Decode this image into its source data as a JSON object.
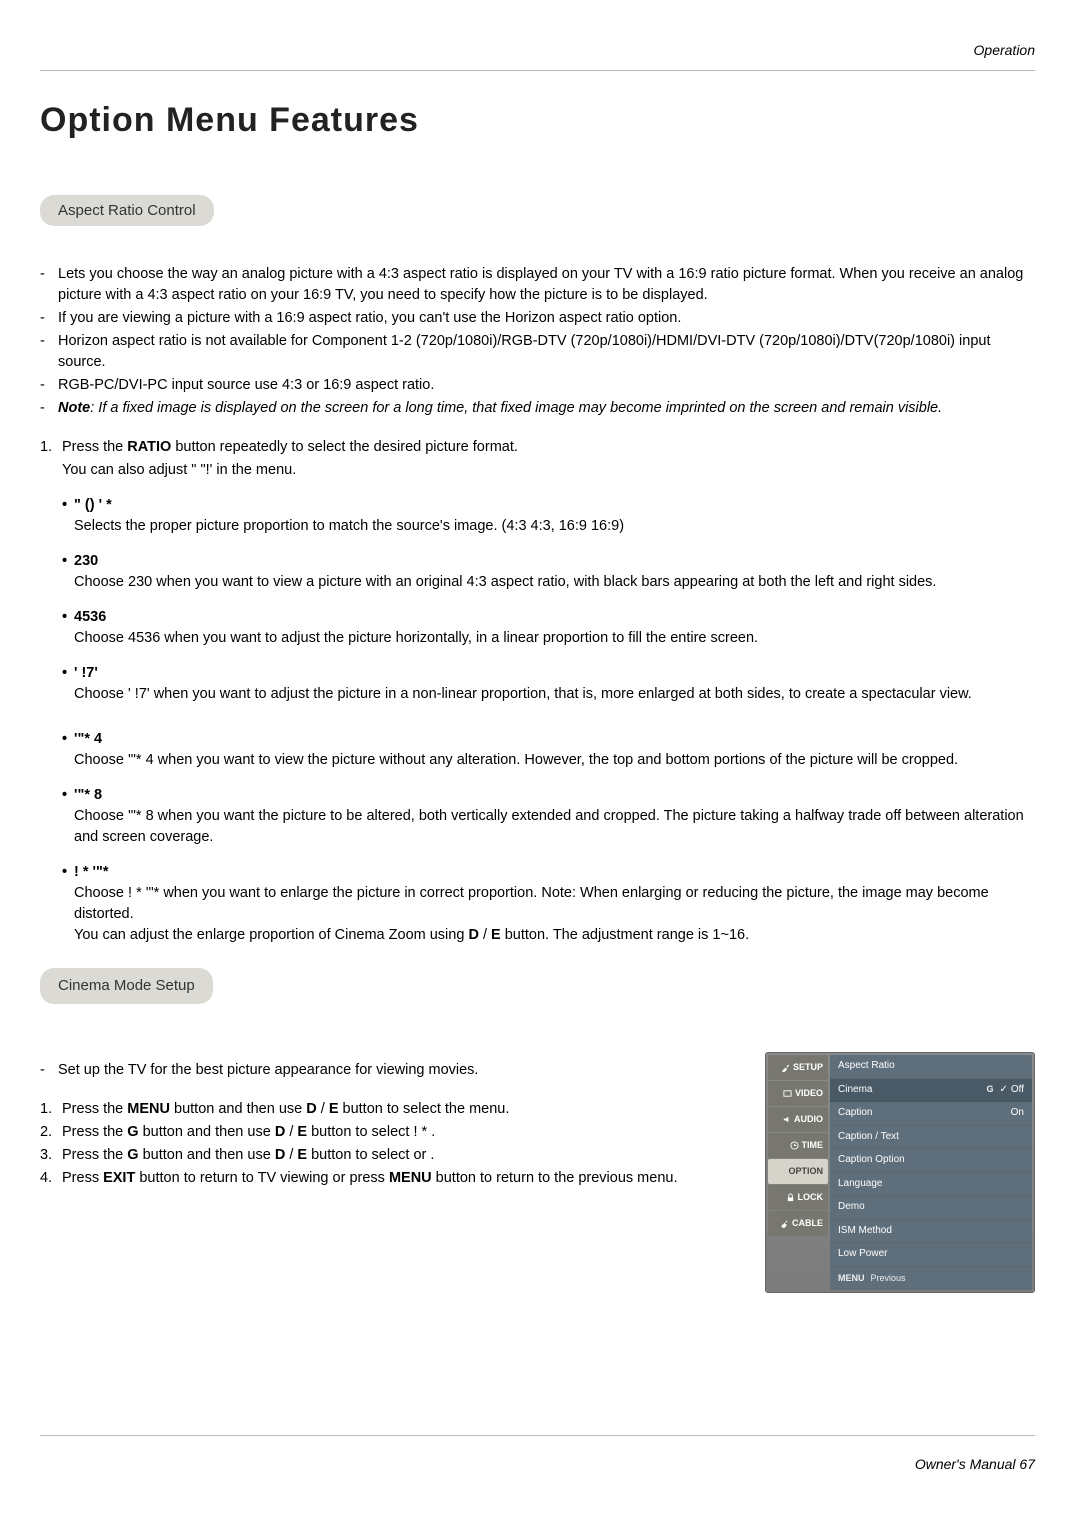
{
  "header": {
    "section": "Operation"
  },
  "title": "Option Menu Features",
  "sections": {
    "aspect": {
      "heading": "Aspect Ratio Control",
      "dashes": [
        "Lets you choose the way an analog picture with a 4:3 aspect ratio is displayed on your TV with a 16:9 ratio picture format. When you receive an analog picture with a 4:3 aspect ratio on your 16:9 TV, you need to specify how the picture is to be displayed.",
        "If you are viewing a picture with a 16:9 aspect ratio, you can't use the Horizon aspect ratio option.",
        "Horizon aspect ratio is not available for Component 1-2 (720p/1080i)/RGB-DTV (720p/1080i)/HDMI/DVI-DTV (720p/1080i)/DTV(720p/1080i) input source.",
        "RGB-PC/DVI-PC input source use 4:3 or 16:9 aspect ratio."
      ],
      "note_label": "Note",
      "note_text": ": If a fixed image is displayed on the screen for a long time, that fixed image may become imprinted on the screen and remain visible.",
      "step1_a": "Press the ",
      "step1_b": "RATIO",
      "step1_c": " button repeatedly to select the desired picture format.",
      "step1_sub_a": "You can also adjust ",
      "step1_sub_b": "\" \"!'",
      "step1_sub_c": " in the ",
      "step1_sub_d": " menu.",
      "bullets": [
        {
          "name": "\" ()  '  *",
          "desc": "Selects the proper picture proportion to match the source's image.  (4:3      4:3, 16:9      16:9)"
        },
        {
          "name": "230",
          "desc": "Choose 230 when you want to view a picture with an original 4:3 aspect ratio, with black bars appearing at both the left and right sides."
        },
        {
          "name": "4536",
          "desc": "Choose 4536 when you want to adjust the picture horizontally, in a linear proportion to fill the entire screen."
        },
        {
          "name": "' !7'",
          "desc": "Choose  ' !7'        when you want to adjust the picture in a non-linear proportion, that is, more enlarged at both sides, to create a spectacular view."
        },
        {
          "name": "'\"* 4",
          "desc": "Choose  '\"* 4        when you want to view the picture without any alteration. However, the top and bottom portions of the picture will be cropped."
        },
        {
          "name": "'\"* 8",
          "desc": "Choose  '\"* 8        when you want the picture to be altered, both vertically extended and cropped. The picture taking a halfway trade off between alteration and screen coverage."
        },
        {
          "name": "! * '\"*",
          "desc_a": "Choose  ! *  '\"*            when you want to enlarge the picture in correct proportion. Note: When enlarging or reducing the picture, the image may become distorted.",
          "desc_b_a": "You can adjust the enlarge proportion of Cinema Zoom using ",
          "desc_b_d": "D",
          "desc_b_slash": " / ",
          "desc_b_e": "E",
          "desc_b_c": " button. The adjustment range is 1~16."
        }
      ]
    },
    "cinema": {
      "heading": "Cinema Mode Setup",
      "dash": "Set up the TV for the best picture appearance for viewing movies.",
      "steps": [
        {
          "a": "Press the ",
          "b": "MENU",
          "c": " button and then use ",
          "d": "D",
          "slash": " / ",
          "e": "E",
          "f": " button to select the ",
          "g": " menu."
        },
        {
          "a": "Press the ",
          "b": "G",
          "c": " button and then use ",
          "d": "D",
          "slash": " / ",
          "e": "E",
          "f": " button to select ",
          "g": "! *      ."
        },
        {
          "a": "Press the ",
          "b": "G",
          "c": " button and then use ",
          "d": "D",
          "slash": " / ",
          "e": "E",
          "f": " button to select        or      ."
        },
        {
          "a": "Press ",
          "b": "EXIT",
          "c": " button to return to TV viewing or press ",
          "b2": "MENU",
          "c2": " button to return to the previous menu."
        }
      ]
    }
  },
  "menu": {
    "tabs": [
      "SETUP",
      "VIDEO",
      "AUDIO",
      "TIME",
      "OPTION",
      "LOCK",
      "CABLE"
    ],
    "rows": [
      {
        "label": "Aspect Ratio",
        "val": ""
      },
      {
        "label": "Cinema",
        "g": "G",
        "check": "✓",
        "val": "Off",
        "hl": true
      },
      {
        "label": "Caption",
        "val": "On"
      },
      {
        "label": "Caption / Text",
        "val": ""
      },
      {
        "label": "Caption Option",
        "val": ""
      },
      {
        "label": "Language",
        "val": ""
      },
      {
        "label": "Demo",
        "val": ""
      },
      {
        "label": "ISM Method",
        "val": ""
      },
      {
        "label": "Low Power",
        "val": ""
      }
    ],
    "footer": {
      "menu": "MENU",
      "prev": "Previous"
    }
  },
  "footer": {
    "text": "Owner's Manual   67"
  }
}
